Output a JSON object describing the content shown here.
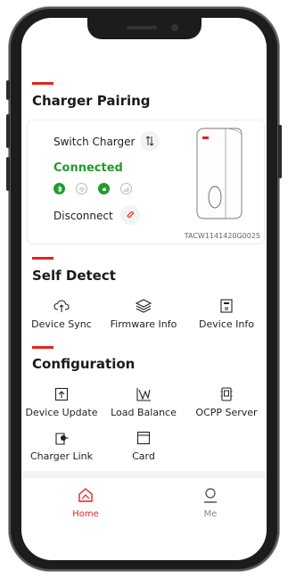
{
  "pairing": {
    "title": "Charger Pairing",
    "switch_label": "Switch Charger",
    "status": "Connected",
    "disconnect_label": "Disconnect",
    "serial": "TACW1141420G0025",
    "indicators": [
      "bluetooth-icon",
      "wifi-icon",
      "signal-icon",
      "cellular-icon"
    ]
  },
  "self_detect": {
    "title": "Self Detect",
    "items": [
      {
        "label": "Device Sync",
        "icon": "cloud-sync-icon"
      },
      {
        "label": "Firmware Info",
        "icon": "layers-icon"
      },
      {
        "label": "Device Info",
        "icon": "device-info-icon"
      }
    ]
  },
  "configuration": {
    "title": "Configuration",
    "items": [
      {
        "label": "Device Update",
        "icon": "upload-icon"
      },
      {
        "label": "Load Balance",
        "icon": "load-balance-icon"
      },
      {
        "label": "OCPP Server",
        "icon": "server-icon"
      },
      {
        "label": "Charger Link",
        "icon": "charger-link-icon"
      },
      {
        "label": "Card",
        "icon": "card-icon"
      }
    ]
  },
  "tabs": [
    {
      "label": "Home",
      "icon": "home-icon",
      "active": true
    },
    {
      "label": "Me",
      "icon": "user-icon",
      "active": false
    }
  ],
  "colors": {
    "accent": "#e4231b",
    "connected": "#1f9c2a"
  }
}
